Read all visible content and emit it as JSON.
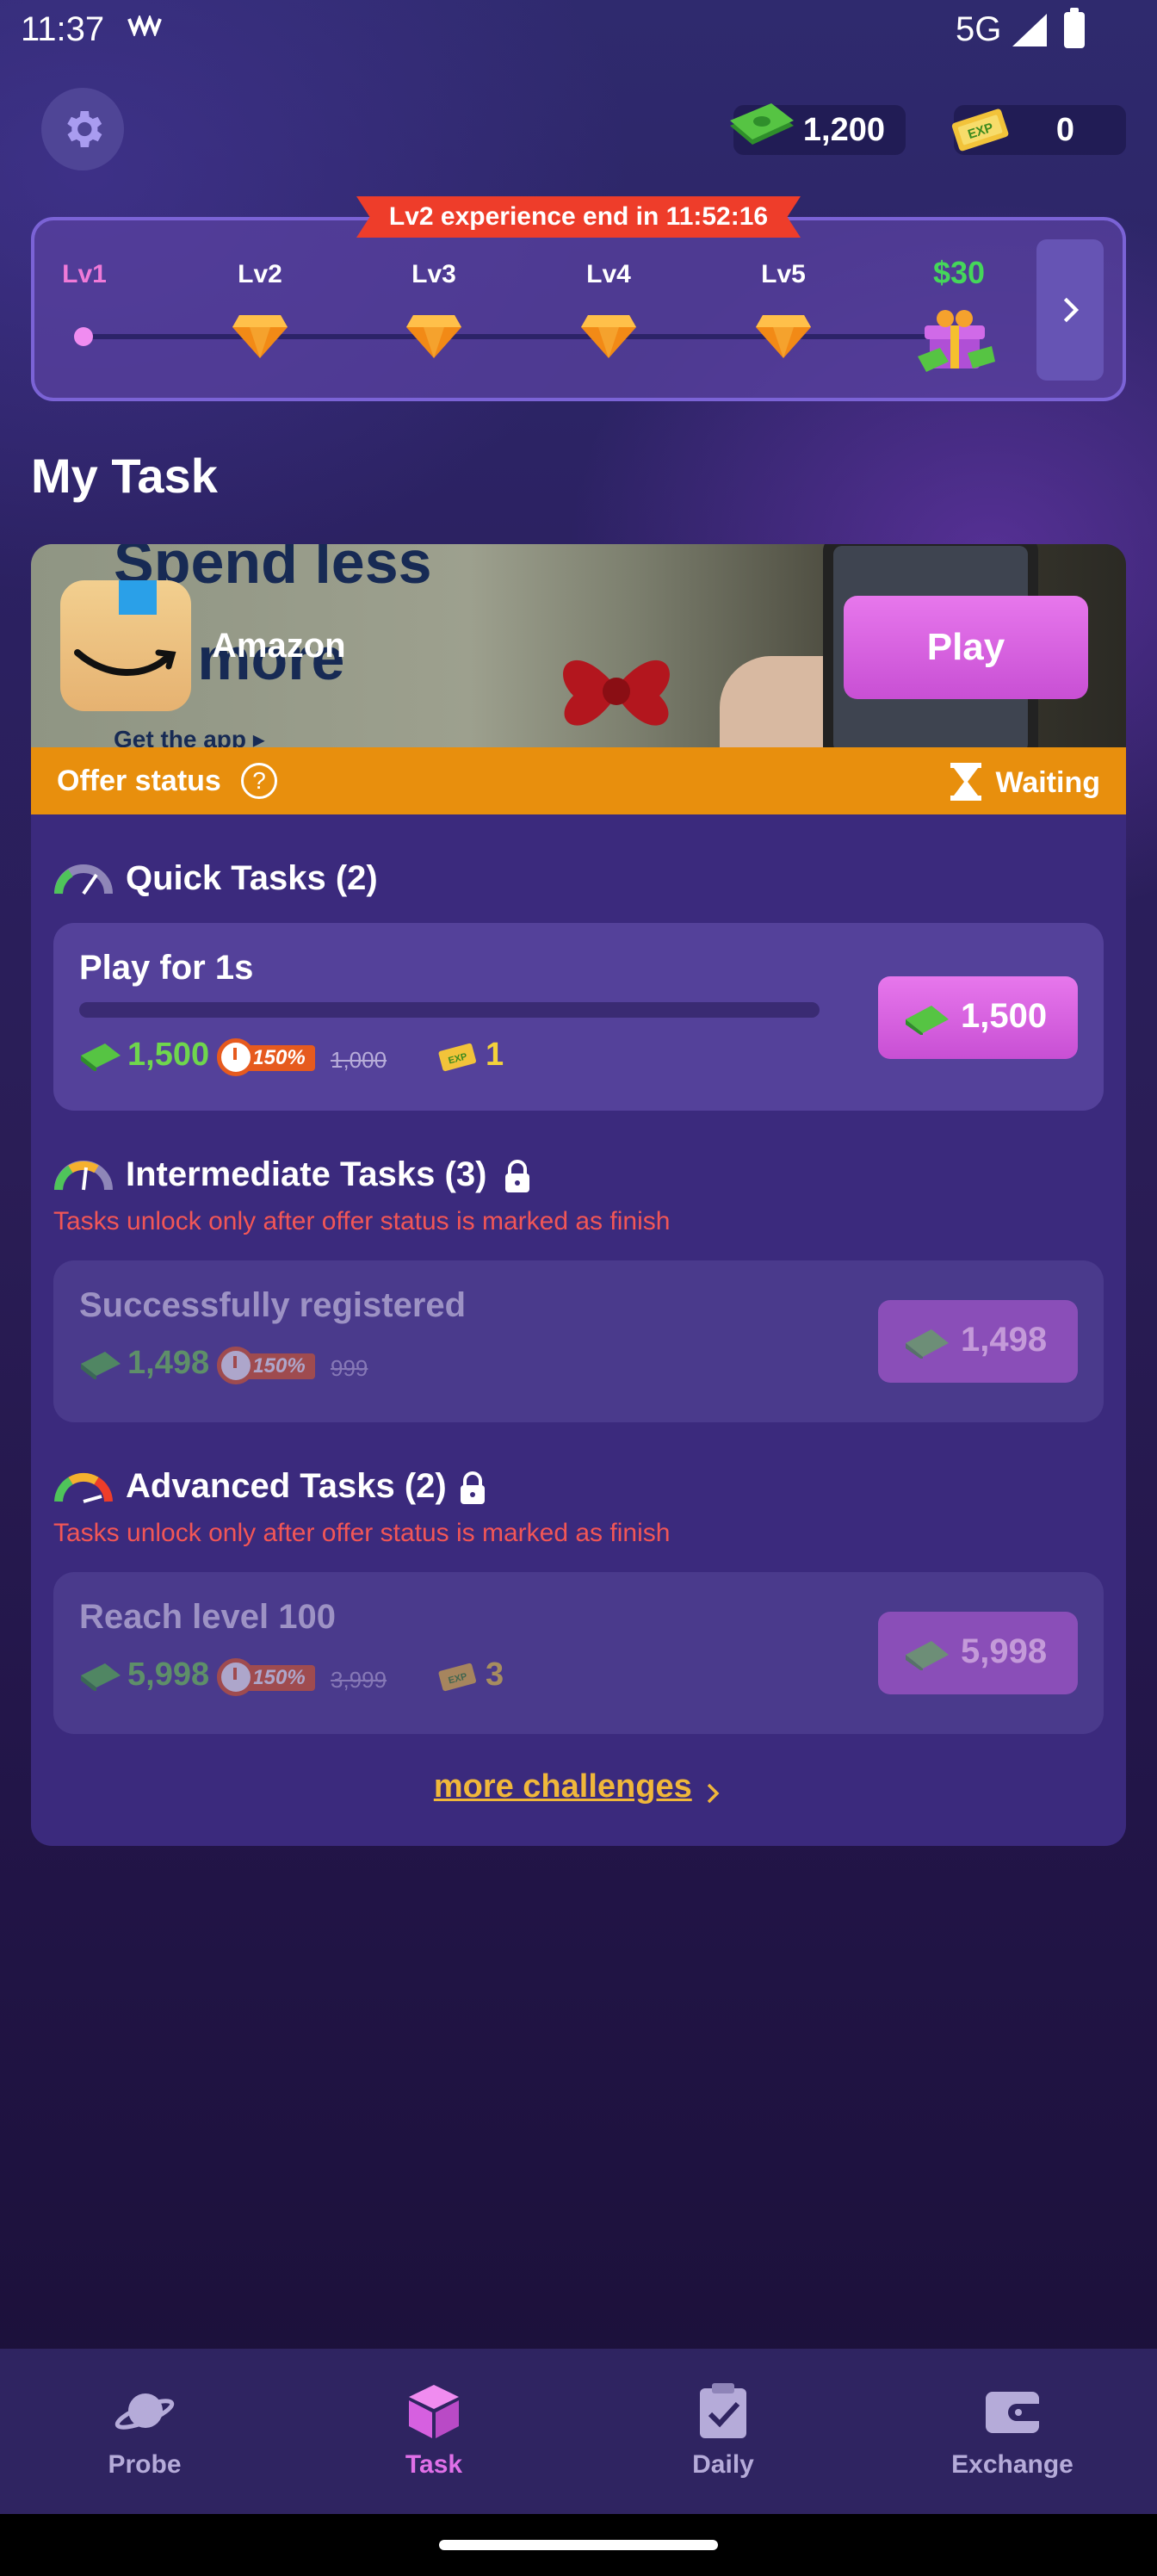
{
  "status_bar": {
    "time": "11:37",
    "carrier_icon_text": "w",
    "network": "5G"
  },
  "top_bar": {
    "cash_balance": "1,200",
    "exp_balance": "0"
  },
  "level": {
    "banner": "Lv2 experience end in 11:52:16",
    "levels": [
      "Lv1",
      "Lv2",
      "Lv3",
      "Lv4",
      "Lv5"
    ],
    "current_level": "Lv1",
    "final_reward": "$30"
  },
  "section_title": "My Task",
  "offer": {
    "app_name": "Amazon",
    "banner_line1": "Spend less",
    "banner_line2": "d",
    "banner_line3": "ile more",
    "banner_small": "Get the app ▸",
    "play_label": "Play",
    "status_label": "Offer status",
    "help_symbol": "?",
    "status_value": "Waiting"
  },
  "groups": [
    {
      "title": "Quick Tasks (2)",
      "locked": false,
      "tasks": [
        {
          "name": "Play for 1s",
          "reward": "1,500",
          "boost": "150%",
          "original": "1,000",
          "exp": "1",
          "claim": "1,500"
        }
      ]
    },
    {
      "title": "Intermediate Tasks (3)",
      "locked": true,
      "warning": "Tasks unlock only after offer status is marked as finish",
      "tasks": [
        {
          "name": "Successfully registered",
          "reward": "1,498",
          "boost": "150%",
          "original": "999",
          "claim": "1,498"
        }
      ]
    },
    {
      "title": "Advanced Tasks (2)",
      "locked": true,
      "warning": "Tasks unlock only after offer status is marked as finish",
      "tasks": [
        {
          "name": "Reach level 100",
          "reward": "5,998",
          "boost": "150%",
          "original": "3,999",
          "exp": "3",
          "claim": "5,998"
        }
      ]
    }
  ],
  "more_link": "more challenges",
  "nav": [
    {
      "label": "Probe",
      "icon": "planet-icon",
      "active": false
    },
    {
      "label": "Task",
      "icon": "cube-icon",
      "active": true
    },
    {
      "label": "Daily",
      "icon": "clipboard-check-icon",
      "active": false
    },
    {
      "label": "Exchange",
      "icon": "wallet-icon",
      "active": false
    }
  ],
  "colors": {
    "accent": "#d660e0",
    "cash_green": "#6fd64d",
    "exp_yellow": "#f4d23b",
    "warning_red": "#f25656",
    "offer_bar": "#e88f0d",
    "banner_red": "#ee3d2a"
  }
}
